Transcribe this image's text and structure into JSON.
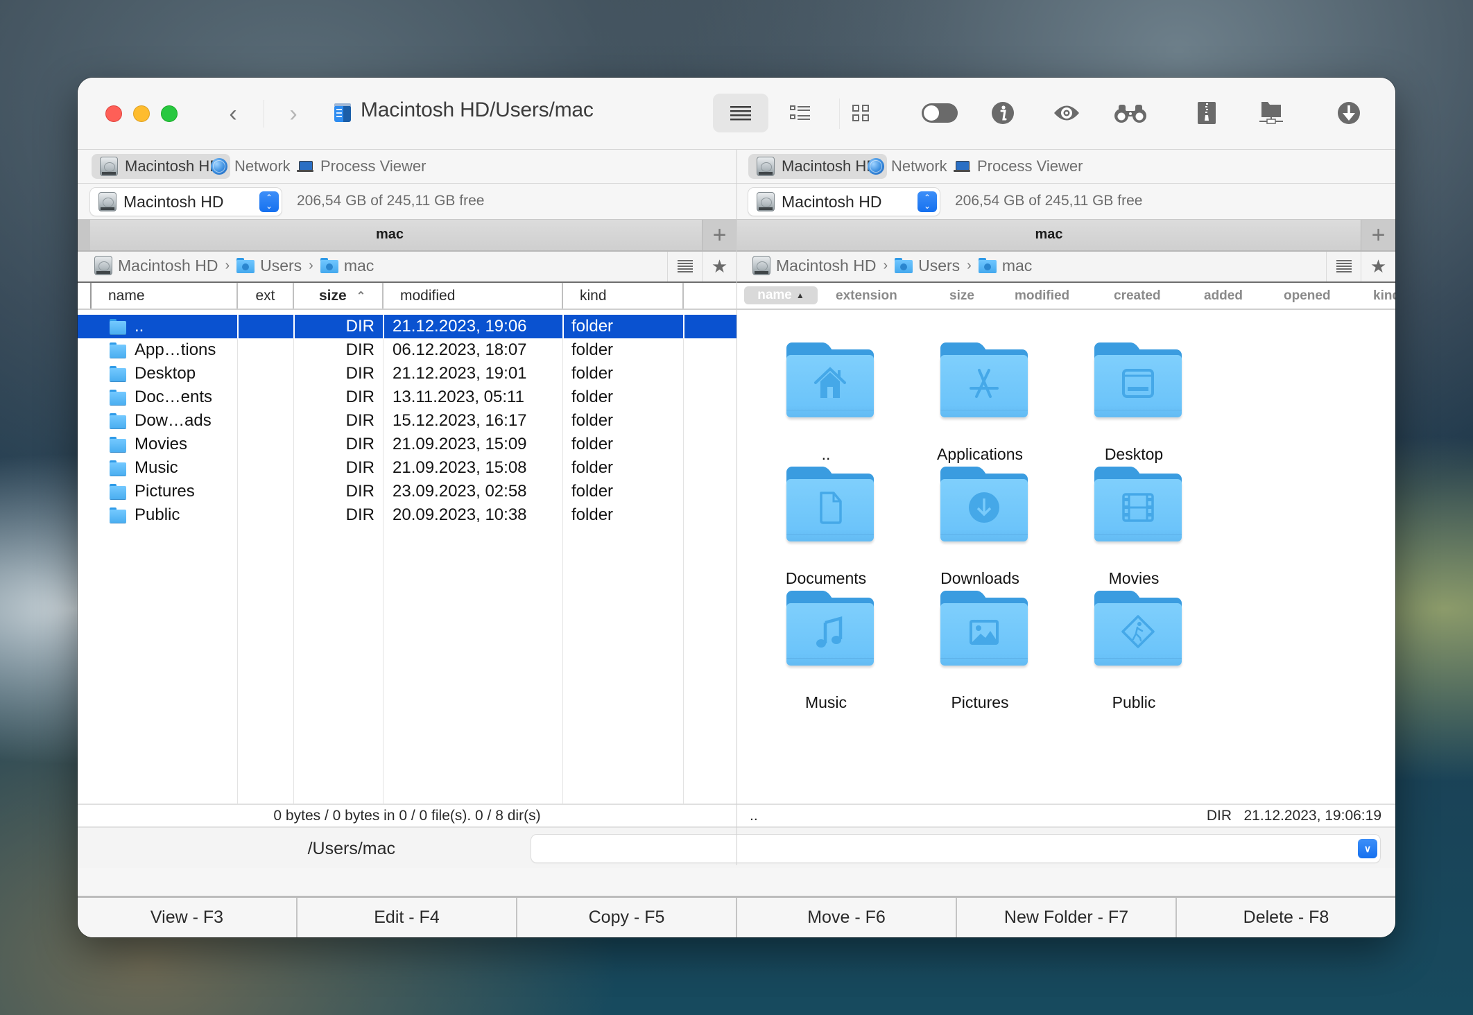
{
  "window": {
    "title": "Macintosh HD/Users/mac",
    "toolbar": [
      {
        "name": "list-view-icon",
        "label": "Brief list view",
        "active": true
      },
      {
        "name": "detail-list-icon",
        "label": "Detailed list view",
        "active": false
      },
      {
        "name": "grid-view-icon",
        "label": "Thumbnails view",
        "active": false
      },
      {
        "name": "toggle-hidden-icon",
        "label": "Show hidden files",
        "active": false
      },
      {
        "name": "info-icon",
        "label": "Get info",
        "active": false
      },
      {
        "name": "eye-icon",
        "label": "Quick look",
        "active": false
      },
      {
        "name": "binoculars-icon",
        "label": "Find",
        "active": false
      },
      {
        "name": "archive-icon",
        "label": "Archive",
        "active": false
      },
      {
        "name": "network-folder-icon",
        "label": "Network connect",
        "active": false
      },
      {
        "name": "download-icon",
        "label": "Download",
        "active": false
      }
    ]
  },
  "left_pane": {
    "tabs": [
      {
        "label": "Macintosh HD",
        "icon": "hard-drive-icon",
        "active": true
      },
      {
        "label": "Network",
        "icon": "globe-icon",
        "active": false
      },
      {
        "label": "Process Viewer",
        "icon": "laptop-icon",
        "active": false
      }
    ],
    "drive": {
      "selected": "Macintosh HD",
      "free_space": "206,54 GB of 245,11 GB free"
    },
    "path_title": "mac",
    "breadcrumb": [
      "Macintosh HD",
      "Users",
      "mac"
    ],
    "columns": {
      "name": "name",
      "ext": "ext",
      "size": "size",
      "modified": "modified",
      "kind": "kind",
      "sorted_by": "size",
      "sort_dir": "ascending"
    },
    "rows": [
      {
        "name": "..",
        "ext": "",
        "size": "DIR",
        "modified": "21.12.2023, 19:06",
        "kind": "folder",
        "selected": true
      },
      {
        "name": "App…tions",
        "ext": "",
        "size": "DIR",
        "modified": "06.12.2023, 18:07",
        "kind": "folder",
        "selected": false
      },
      {
        "name": "Desktop",
        "ext": "",
        "size": "DIR",
        "modified": "21.12.2023, 19:01",
        "kind": "folder",
        "selected": false
      },
      {
        "name": "Doc…ents",
        "ext": "",
        "size": "DIR",
        "modified": "13.11.2023, 05:11",
        "kind": "folder",
        "selected": false
      },
      {
        "name": "Dow…ads",
        "ext": "",
        "size": "DIR",
        "modified": "15.12.2023, 16:17",
        "kind": "folder",
        "selected": false
      },
      {
        "name": "Movies",
        "ext": "",
        "size": "DIR",
        "modified": "21.09.2023, 15:09",
        "kind": "folder",
        "selected": false
      },
      {
        "name": "Music",
        "ext": "",
        "size": "DIR",
        "modified": "21.09.2023, 15:08",
        "kind": "folder",
        "selected": false
      },
      {
        "name": "Pictures",
        "ext": "",
        "size": "DIR",
        "modified": "23.09.2023, 02:58",
        "kind": "folder",
        "selected": false
      },
      {
        "name": "Public",
        "ext": "",
        "size": "DIR",
        "modified": "20.09.2023, 10:38",
        "kind": "folder",
        "selected": false
      }
    ],
    "status": "0 bytes / 0 bytes in 0 / 0 file(s). 0 / 8 dir(s)"
  },
  "right_pane": {
    "tabs": [
      {
        "label": "Macintosh HD",
        "icon": "hard-drive-icon",
        "active": true
      },
      {
        "label": "Network",
        "icon": "globe-icon",
        "active": false
      },
      {
        "label": "Process Viewer",
        "icon": "laptop-icon",
        "active": false
      }
    ],
    "drive": {
      "selected": "Macintosh HD",
      "free_space": "206,54 GB of 245,11 GB free"
    },
    "path_title": "mac",
    "breadcrumb": [
      "Macintosh HD",
      "Users",
      "mac"
    ],
    "columns": [
      "name",
      "extension",
      "size",
      "modified",
      "created",
      "added",
      "opened",
      "kind"
    ],
    "sort_indicator": "▲",
    "items": [
      {
        "label": "..",
        "glyph": "home"
      },
      {
        "label": "Applications",
        "glyph": "apps"
      },
      {
        "label": "Desktop",
        "glyph": "desktop"
      },
      {
        "label": "Documents",
        "glyph": "document"
      },
      {
        "label": "Downloads",
        "glyph": "download"
      },
      {
        "label": "Movies",
        "glyph": "film"
      },
      {
        "label": "Music",
        "glyph": "music"
      },
      {
        "label": "Pictures",
        "glyph": "picture"
      },
      {
        "label": "Public",
        "glyph": "public"
      }
    ],
    "status_left": "..",
    "status_right": "DIR   21.12.2023, 19:06:19"
  },
  "command_line": {
    "path": "/Users/mac",
    "value": "",
    "placeholder": ""
  },
  "function_keys": [
    {
      "label": "View - F3"
    },
    {
      "label": "Edit - F4"
    },
    {
      "label": "Copy - F5"
    },
    {
      "label": "Move - F6"
    },
    {
      "label": "New Folder - F7"
    },
    {
      "label": "Delete - F8"
    }
  ]
}
